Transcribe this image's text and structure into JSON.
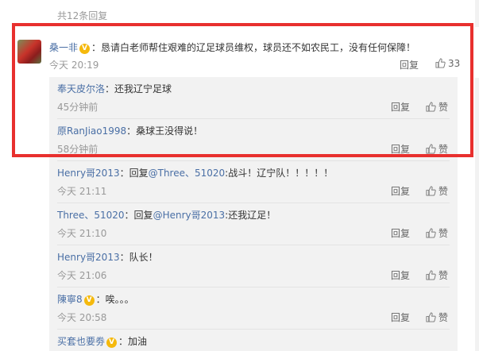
{
  "header": {
    "count_label": "共12条回复"
  },
  "main_comment": {
    "username": "桑一非",
    "text": "：恳请白老师帮住艰难的辽足球员维权，球员还不如农民工，没有任何保障！",
    "time": "今天 20:19",
    "reply_label": "回复",
    "like_count": "33"
  },
  "replies": [
    {
      "username": "奉天皮尔洛",
      "text": "：还我辽宁足球",
      "time": "45分钟前",
      "reply_label": "回复",
      "like_label": "赞"
    },
    {
      "username": "原RanJiao1998",
      "text": "：桑球王没得说！",
      "time": "58分钟前",
      "reply_label": "回复",
      "like_label": "赞"
    },
    {
      "username": "Henry哥2013",
      "pre": "：回复",
      "mention": "@Three、51020",
      "text": ":战斗！辽宁队！！！！！",
      "time": "今天 21:11",
      "reply_label": "回复",
      "like_label": "赞"
    },
    {
      "username": "Three、51020",
      "pre": "：回复",
      "mention": "@Henry哥2013",
      "text": ":还我辽足！",
      "time": "今天 21:10",
      "reply_label": "回复",
      "like_label": "赞"
    },
    {
      "username": "Henry哥2013",
      "text": "：队长！",
      "time": "今天 21:06",
      "reply_label": "回复",
      "like_label": "赞"
    },
    {
      "username": "陳寧8",
      "text": "：唉。。。",
      "time": "今天 20:58",
      "reply_label": "回复",
      "like_label": "赞"
    },
    {
      "username": "买套也要劵",
      "text": "：加油"
    }
  ],
  "colors": {
    "highlight": "#e8302e",
    "link": "#4a6fa5",
    "vip_badge": "#f5b90d"
  }
}
